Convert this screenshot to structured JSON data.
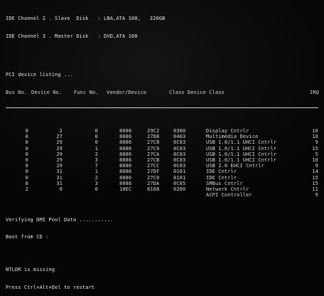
{
  "ide": {
    "channel2": "IDE Channel 2 . Slave  Disk   : LBA,ATA 100,   320GB",
    "channel3": "IDE Channel 3 . Master Disk   : DVD,ATA 100"
  },
  "pci": {
    "title": "PCI device listing ...",
    "headers": {
      "bus": "Bus No.",
      "device": "Device No.",
      "func": "Func No.",
      "vendor_device": "Vendor/Device",
      "class": "Class",
      "device_class": "Device Class",
      "irq": "IRQ"
    },
    "rows": [
      {
        "bus": "0",
        "dev": "2",
        "func": "0",
        "vendor": "8086",
        "device": "29C2",
        "cls": "0300",
        "desc": "Display Cntrlr",
        "irq": "10"
      },
      {
        "bus": "0",
        "dev": "27",
        "func": "0",
        "vendor": "8086",
        "device": "27D8",
        "cls": "0403",
        "desc": "Multimedia Device",
        "irq": "10"
      },
      {
        "bus": "0",
        "dev": "29",
        "func": "0",
        "vendor": "8086",
        "device": "27C8",
        "cls": "0C03",
        "desc": "USB 1.0/1.1 UHCI Cntrlr",
        "irq": "9"
      },
      {
        "bus": "0",
        "dev": "29",
        "func": "1",
        "vendor": "8086",
        "device": "27C9",
        "cls": "0C03",
        "desc": "USB 1.0/1.1 UHCI Cntrlr",
        "irq": "15"
      },
      {
        "bus": "0",
        "dev": "29",
        "func": "2",
        "vendor": "8086",
        "device": "27CA",
        "cls": "0C03",
        "desc": "USB 1.0/1.1 UHCI Cntrlr",
        "irq": "5"
      },
      {
        "bus": "0",
        "dev": "29",
        "func": "3",
        "vendor": "8086",
        "device": "27CB",
        "cls": "0C03",
        "desc": "USB 1.0/1.1 UHCI Cntrlr",
        "irq": "10"
      },
      {
        "bus": "0",
        "dev": "29",
        "func": "7",
        "vendor": "8086",
        "device": "27CC",
        "cls": "0C03",
        "desc": "USB 2.0 EHCI Cntrlr",
        "irq": "9"
      },
      {
        "bus": "0",
        "dev": "31",
        "func": "1",
        "vendor": "8086",
        "device": "27DF",
        "cls": "0101",
        "desc": "IDE Cntrlr",
        "irq": "14"
      },
      {
        "bus": "0",
        "dev": "31",
        "func": "2",
        "vendor": "8086",
        "device": "27C0",
        "cls": "0101",
        "desc": "IDE Cntrlr",
        "irq": "15"
      },
      {
        "bus": "0",
        "dev": "31",
        "func": "3",
        "vendor": "8086",
        "device": "27DA",
        "cls": "0C05",
        "desc": "SMBus Cntrlr",
        "irq": "15"
      },
      {
        "bus": "2",
        "dev": "0",
        "func": "0",
        "vendor": "10EC",
        "device": "8168",
        "cls": "0200",
        "desc": "Network Cntrlr",
        "irq": "11"
      },
      {
        "bus": "",
        "dev": "",
        "func": "",
        "vendor": "",
        "device": "",
        "cls": "",
        "desc": "ACPI Controller",
        "irq": "9"
      }
    ]
  },
  "boot": {
    "dmi": "Verifying DMI Pool Data ...........",
    "cd": "Boot from CD :",
    "error": "NTLDR is missing",
    "restart": "Press Ctrl+Alt+Del to restart"
  }
}
